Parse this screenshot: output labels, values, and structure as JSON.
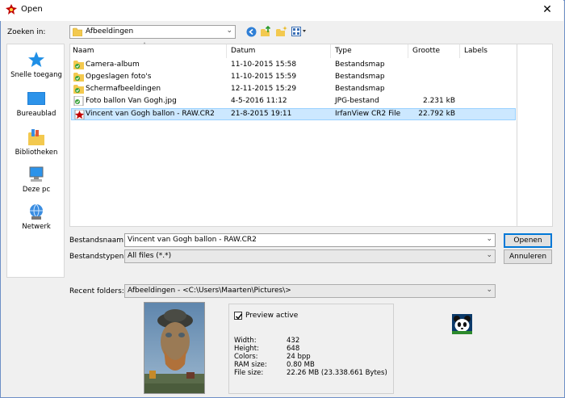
{
  "window": {
    "title": "Open",
    "close_symbol": "✕"
  },
  "toolbar": {
    "look_in_label": "Zoeken in:",
    "look_in_value": "Afbeeldingen"
  },
  "sidebar": {
    "items": [
      {
        "label": "Snelle toegang",
        "icon": "star-icon"
      },
      {
        "label": "Bureaublad",
        "icon": "desktop-icon"
      },
      {
        "label": "Bibliotheken",
        "icon": "library-icon"
      },
      {
        "label": "Deze pc",
        "icon": "computer-icon"
      },
      {
        "label": "Netwerk",
        "icon": "network-icon"
      }
    ]
  },
  "filelist": {
    "columns": [
      "Naam",
      "Datum",
      "Type",
      "Grootte",
      "Labels"
    ],
    "rows": [
      {
        "name": "Camera-album",
        "date": "11-10-2015 15:58",
        "type": "Bestandsmap",
        "size": "",
        "icon": "folder-icon"
      },
      {
        "name": "Opgeslagen foto's",
        "date": "11-10-2015 15:59",
        "type": "Bestandsmap",
        "size": "",
        "icon": "folder-icon"
      },
      {
        "name": "Schermafbeeldingen",
        "date": "12-11-2015 15:29",
        "type": "Bestandsmap",
        "size": "",
        "icon": "folder-icon"
      },
      {
        "name": "Foto ballon Van Gogh.jpg",
        "date": "4-5-2016 11:12",
        "type": "JPG-bestand",
        "size": "2.231 kB",
        "icon": "image-file-icon"
      },
      {
        "name": "Vincent van Gogh ballon - RAW.CR2",
        "date": "21-8-2015 19:11",
        "type": "IrfanView CR2 File",
        "size": "22.792 kB",
        "icon": "irfanview-file-icon"
      }
    ]
  },
  "fields": {
    "filename_label": "Bestandsnaam:",
    "filename_value": "Vincent van Gogh ballon - RAW.CR2",
    "filetype_label": "Bestandstypen:",
    "filetype_value": "All files (*.*)",
    "recent_label": "Recent folders:",
    "recent_value": "Afbeeldingen  -  <C:\\Users\\Maarten\\Pictures\\>"
  },
  "buttons": {
    "open": "Openen",
    "cancel": "Annuleren"
  },
  "preview": {
    "checkbox_label": "Preview active",
    "checked": true,
    "info": [
      {
        "k": "Width:",
        "v": "432"
      },
      {
        "k": "Height:",
        "v": "648"
      },
      {
        "k": "Colors:",
        "v": "24 bpp"
      },
      {
        "k": "RAM size:",
        "v": "0.80 MB"
      },
      {
        "k": "File size:",
        "v": "22.26 MB (23.338.661 Bytes)"
      }
    ]
  },
  "colors": {
    "selection": "#cce8ff",
    "accent": "#0078d7",
    "folder": "#f3c94f"
  }
}
